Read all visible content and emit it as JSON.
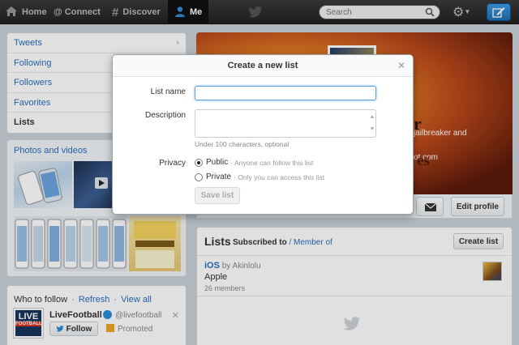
{
  "topbar": {
    "home": "Home",
    "connect": "@ Connect",
    "discover": "Discover",
    "me": "Me",
    "search_placeholder": "Search"
  },
  "sidebar": {
    "items": [
      {
        "label": "Tweets"
      },
      {
        "label": "Following"
      },
      {
        "label": "Followers"
      },
      {
        "label": "Favorites"
      },
      {
        "label": "Lists"
      }
    ],
    "photos_title": "Photos and videos"
  },
  "who_to_follow": {
    "title": "Who to follow",
    "refresh": "Refresh",
    "view_all": "View all",
    "separator": "·",
    "account_name": "LiveFootball",
    "account_handle": "@livefootball",
    "logo_top": "LIVE",
    "logo_bottom": "FOOTBALL",
    "follow_label": "Follow",
    "promoted_label": "Promoted"
  },
  "profile_header": {
    "fragment_1": "r",
    "fragment_2": "jailbreaker and",
    "fragment_3": "ot.com",
    "fragment_4": "es",
    "edit_profile_label": "Edit profile"
  },
  "lists_panel": {
    "title": "Lists",
    "subscribed_label": "Subscribed to",
    "member_of_label": "/ Member of",
    "create_label": "Create list",
    "item": {
      "name": "iOS",
      "by": "by Akinlolu",
      "description": "Apple",
      "members": "26 members"
    }
  },
  "modal": {
    "title": "Create a new list",
    "name_label": "List name",
    "name_value": "",
    "description_label": "Description",
    "description_hint": "Under 100 characters, optional",
    "privacy_label": "Privacy",
    "public_label": "Public",
    "public_hint": "· Anyone can follow this list",
    "private_label": "Private",
    "private_hint": "· Only you can access this list",
    "save_label": "Save list",
    "selected_privacy": "public"
  },
  "colors": {
    "link": "#2a6ebd",
    "topbar": "#2a2a2a",
    "accent_blue": "#2a8ed9"
  }
}
